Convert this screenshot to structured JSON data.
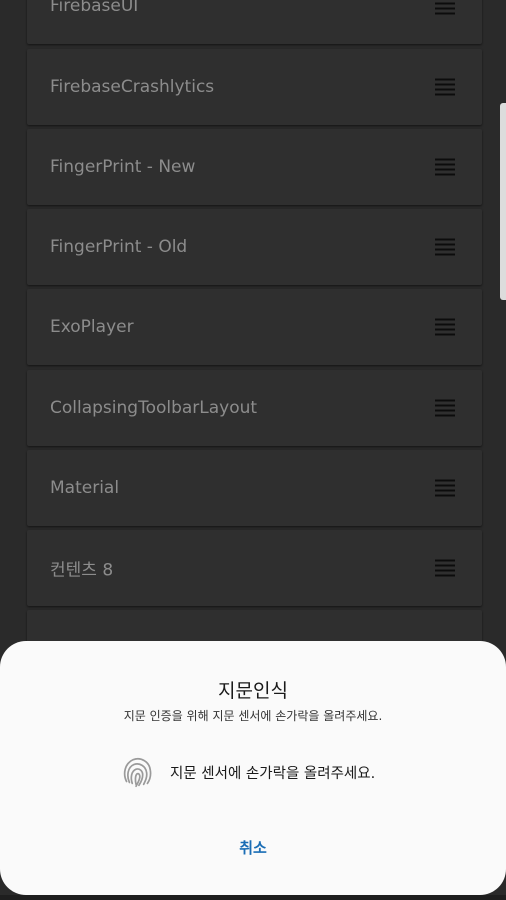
{
  "list": {
    "items": [
      {
        "label": "FirebaseUI"
      },
      {
        "label": "FirebaseCrashlytics"
      },
      {
        "label": "FingerPrint - New"
      },
      {
        "label": "FingerPrint - Old"
      },
      {
        "label": "ExoPlayer"
      },
      {
        "label": "CollapsingToolbarLayout"
      },
      {
        "label": "Material"
      },
      {
        "label": "컨텐츠 8"
      }
    ],
    "drag_icon": "drag-handle-icon"
  },
  "dialog": {
    "title": "지문인식",
    "subtitle": "지문 인증을 위해 지문 센서에 손가락을 올려주세요.",
    "prompt": "지문 센서에 손가락을 올려주세요.",
    "icon": "fingerprint-icon",
    "cancel_label": "취소"
  },
  "colors": {
    "accent": "#1a6db5",
    "sheet_background": "#fafafa",
    "dimmed_background": "#2a2a2a"
  }
}
